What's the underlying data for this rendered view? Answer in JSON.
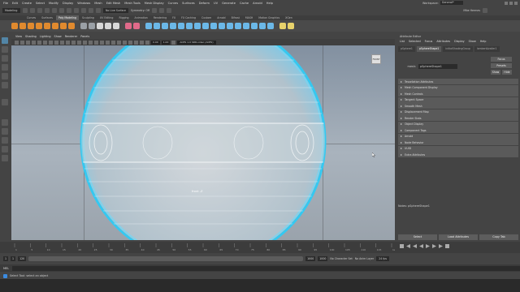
{
  "menubar": {
    "items": [
      "File",
      "Edit",
      "Create",
      "Select",
      "Modify",
      "Display",
      "Windows",
      "Mesh",
      "Edit Mesh",
      "Mesh Tools",
      "Mesh Display",
      "Curves",
      "Surfaces",
      "Deform",
      "UV",
      "Generate",
      "Cache",
      "Arnold",
      "Help"
    ],
    "workspace_label": "Workspace:",
    "workspace_value": "General*"
  },
  "statusline": {
    "mode": "Modeling",
    "no_live_surface": "No Live Surface",
    "symmetry": "Symmetry: Off",
    "login": "Mike Hermes"
  },
  "shelf": {
    "tabs": [
      "Curves",
      "Surfaces",
      "Poly Modeling",
      "Sculpting",
      "UV Editing",
      "Rigging",
      "Animation",
      "Rendering",
      "FX",
      "FX Caching",
      "Custom",
      "Arnold",
      "Bifrost",
      "MASH",
      "Motion Graphics",
      "XGen"
    ],
    "active_tab": "Poly Modeling",
    "icon_colors": [
      "#e08a2e",
      "#e08a2e",
      "#e08a2e",
      "#e08a2e",
      "#e08a2e",
      "#e08a2e",
      "#e08a2e",
      "#e08a2e",
      "#9aa0a6",
      "#9aa0a6",
      "#d8d8d8",
      "#d8d8d8",
      "#d8d8d8",
      "#e06a8a",
      "#e06a8a",
      "#6bb8e8",
      "#6bb8e8",
      "#6bb8e8",
      "#6bb8e8",
      "#6bb8e8",
      "#6bb8e8",
      "#6bb8e8",
      "#6bb8e8",
      "#6bb8e8",
      "#6bb8e8",
      "#6bb8e8",
      "#6bb8e8",
      "#6bb8e8",
      "#6bb8e8",
      "#6bb8e8",
      "#6bb8e8",
      "#e8d26b",
      "#e8d26b"
    ]
  },
  "panel": {
    "menu": [
      "View",
      "Shading",
      "Lighting",
      "Show",
      "Renderer",
      "Panels"
    ],
    "near_clip": "0.00",
    "far_clip": "1.00",
    "color_space": "ACES 1.0 SDR-video (ACES)",
    "camera_label": "front -Z",
    "viewcube_label": "FRONT"
  },
  "attribute_editor": {
    "title": "Attribute Editor",
    "menu": [
      "List",
      "Selected",
      "Focus",
      "Attributes",
      "Display",
      "Show",
      "Help"
    ],
    "node_tabs": [
      "pSphere1",
      "pSphereShape1",
      "initialShadingGroup",
      "lambertAvailer1"
    ],
    "active_node_tab": "pSphereShape1",
    "mesh_label": "mesh:",
    "mesh_value": "pSphereShape1",
    "focus_button": "Focus",
    "presets_button": "Presets",
    "show_button": "Show",
    "hide_button": "Hide",
    "sections": [
      "Tessellation Attributes",
      "Mesh Component Display",
      "Mesh Controls",
      "Tangent Space",
      "Smooth Mesh",
      "Displacement Map",
      "Render Stats",
      "Object Display",
      "Component Tags",
      "Arnold",
      "Node Behavior",
      "UUID",
      "Extra Attributes"
    ],
    "notes": "Notes: pSphereShape1",
    "buttons": [
      "Select",
      "Load Attributes",
      "Copy Tab"
    ]
  },
  "time": {
    "start_frame": "1",
    "end_frame": "120",
    "range_start": "1",
    "range_end": "120",
    "range_end2": "1000",
    "range_end3": "1000",
    "character_set": "No Character Set",
    "anim_layer": "No Anim Layer",
    "fps": "24 fps",
    "ticks": [
      "1",
      "5",
      "10",
      "15",
      "20",
      "25",
      "30",
      "35",
      "40",
      "45",
      "50",
      "55",
      "60",
      "65",
      "70",
      "75",
      "80",
      "85",
      "90",
      "95",
      "100",
      "105",
      "110",
      "115",
      "120"
    ]
  },
  "cmdline": {
    "language": "MEL"
  },
  "helpline": {
    "text": "Select Tool: select an object"
  }
}
